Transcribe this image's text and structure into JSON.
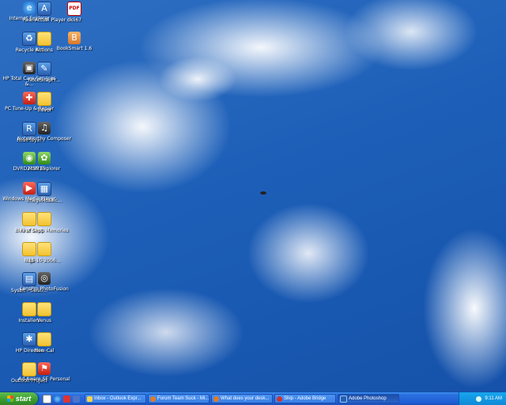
{
  "desktop": {
    "icons": [
      {
        "label": "Internet Explorer",
        "icon": "internet-explorer-icon"
      },
      {
        "label": "Real-Actual Player",
        "icon": "player-app-icon"
      },
      {
        "label": "dkli67",
        "icon": "pdf-file-icon",
        "badge": "PDF"
      },
      {
        "label": "Recycle Bin",
        "icon": "recycle-bin-icon"
      },
      {
        "label": "Actions",
        "icon": "folder-icon"
      },
      {
        "label": "BookSmart 1.6",
        "icon": "booksmart-icon"
      },
      {
        "label": "HP Total Care Services &...",
        "icon": "hp-care-icon"
      },
      {
        "label": "NoteSnapPr...",
        "icon": "app-icon"
      },
      {
        "label": "PC Tune-Up & Repair",
        "icon": "tune-up-icon"
      },
      {
        "label": "Trevor",
        "icon": "folder-icon"
      },
      {
        "label": "RealPlayer",
        "icon": "realplayer-icon"
      },
      {
        "label": "NoteWorthy Composer",
        "icon": "composer-icon"
      },
      {
        "label": "DVRD21XP16",
        "icon": "dvd-icon"
      },
      {
        "label": "MSN Explorer",
        "icon": "msn-icon"
      },
      {
        "label": "Windows Media Player",
        "icon": "media-player-icon"
      },
      {
        "label": "ImageMosaic...",
        "icon": "image-app-icon"
      },
      {
        "label": "Bird of Shop",
        "icon": "folder-icon"
      },
      {
        "label": "First Sept. Memories",
        "icon": "folder-icon"
      },
      {
        "label": "Nigs",
        "icon": "folder-icon"
      },
      {
        "label": "11-10-2006...",
        "icon": "folder-icon"
      },
      {
        "label": "Sysbit - Swan...",
        "icon": "system-app-icon"
      },
      {
        "label": "LensPro PhotoFusion",
        "icon": "lens-icon"
      },
      {
        "label": "Installers",
        "icon": "folder-icon"
      },
      {
        "label": "Venus",
        "icon": "folder-icon"
      },
      {
        "label": "HP Director",
        "icon": "hp-director-icon"
      },
      {
        "label": "New-Cal",
        "icon": "folder-icon"
      },
      {
        "label": "Outlook Project",
        "icon": "folder-icon"
      },
      {
        "label": "Ad-Aware SE Personal",
        "icon": "ad-aware-icon"
      }
    ]
  },
  "taskbar": {
    "start_label": "start",
    "tasks": [
      {
        "label": "Inbox - Outlook Expr...",
        "icon": "outlook-icon",
        "active": false
      },
      {
        "label": "Forum Team Suck - Mi...",
        "icon": "browser-icon",
        "active": false
      },
      {
        "label": "What does your desk...",
        "icon": "browser-icon",
        "active": false
      },
      {
        "label": "Ship - Adobe Bridge",
        "icon": "bridge-icon",
        "active": false
      },
      {
        "label": "Adobe Photoshop",
        "icon": "photoshop-icon",
        "active": true
      }
    ],
    "clock": "9:11 AM"
  }
}
